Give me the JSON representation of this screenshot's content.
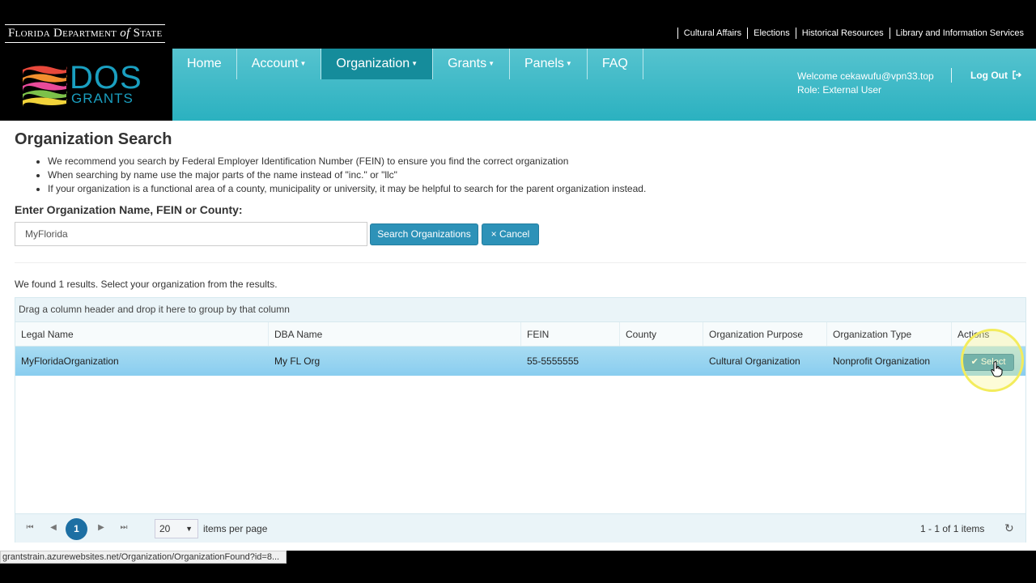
{
  "top": {
    "dept_prefix": "Florida Department",
    "dept_of": "of",
    "dept_suffix": "State",
    "links": [
      "Cultural Affairs",
      "Elections",
      "Historical Resources",
      "Library and Information Services"
    ]
  },
  "header": {
    "logo_dos": "DOS",
    "logo_grants": "GRANTS",
    "nav": [
      {
        "label": "Home",
        "caret": ""
      },
      {
        "label": "Account",
        "caret": "▼"
      },
      {
        "label": "Organization",
        "caret": "▼"
      },
      {
        "label": "Grants",
        "caret": "▼"
      },
      {
        "label": "Panels",
        "caret": "▼"
      },
      {
        "label": "FAQ",
        "caret": ""
      }
    ],
    "welcome": "Welcome cekawufu@vpn33.top",
    "role": "Role: External User",
    "logout": "Log Out"
  },
  "page": {
    "title": "Organization Search",
    "tips": [
      "We recommend you search by Federal Employer Identification Number (FEIN) to ensure you find the correct organization",
      "When searching by name use the major parts of the name instead of \"inc.\" or \"llc\"",
      "If your organization is a functional area of a county, municipality or university, it may be helpful to search for the parent organization instead."
    ],
    "search_label": "Enter Organization Name, FEIN or County:",
    "search_value": "MyFlorida",
    "search_button": "Search Organizations",
    "cancel_button": "× Cancel",
    "results_message": "We found 1 results. Select your organization from the results."
  },
  "grid": {
    "group_hint": "Drag a column header and drop it here to group by that column",
    "columns": [
      "Legal Name",
      "DBA Name",
      "FEIN",
      "County",
      "Organization Purpose",
      "Organization Type",
      "Actions"
    ],
    "rows": [
      [
        "MyFloridaOrganization",
        "My FL Org",
        "55-5555555",
        "",
        "Cultural Organization",
        "Nonprofit Organization"
      ]
    ],
    "select_label": "✔ Select",
    "pager": {
      "current_page": "1",
      "page_size": "20",
      "per_page_label": "items per page",
      "info": "1 - 1 of 1 items"
    }
  },
  "status_url": "grantstrain.azurewebsites.net/Organization/OrganizationFound?id=8..."
}
